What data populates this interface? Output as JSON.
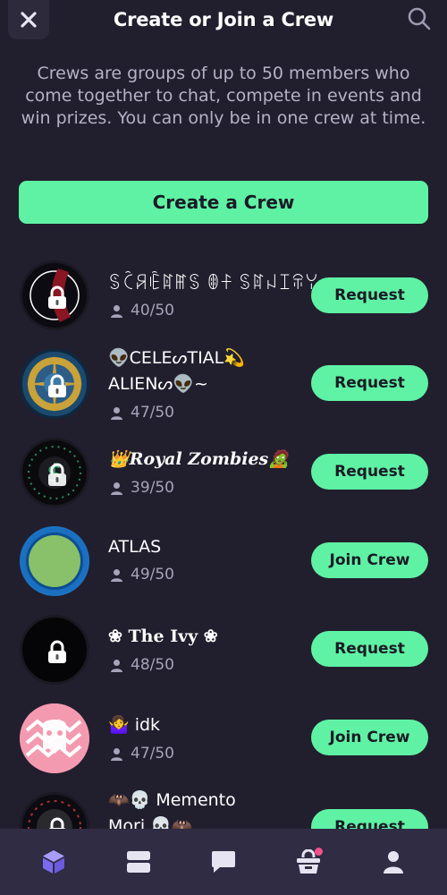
{
  "header": {
    "title": "Create or Join a Crew",
    "close_icon": "close-icon",
    "search_icon": "search-icon"
  },
  "description": "Crews are groups of up to 50 members who come together to chat, compete in events and win prizes. You can only be in one crew at time.",
  "create_button": "Create a Crew",
  "crews": [
    {
      "name_line1": "ꌗꉓꋪꍟꍏꂵꌗ ꂦꊰ ꌗꍏꈤꀤꋖꌩ",
      "name_line2": "",
      "count": "40/50",
      "action": "Request",
      "locked": true
    },
    {
      "name_line1": "👽CELEᔕTIAL💫",
      "name_line2": "ALIENᔕ👽~",
      "count": "47/50",
      "action": "Request",
      "locked": true
    },
    {
      "name_line1": "👑𝑹𝒐𝒚𝒂𝒍 𝒁𝒐𝒎𝒃𝒊𝒆𝒔🧟",
      "name_line2": "",
      "count": "39/50",
      "action": "Request",
      "locked": true
    },
    {
      "name_line1": "ATLAS",
      "name_line2": "",
      "count": "49/50",
      "action": "Join Crew",
      "locked": false
    },
    {
      "name_line1": "❀ 𝐓𝐡𝐞 𝐈𝐯𝐲 ❀",
      "name_line2": "",
      "count": "48/50",
      "action": "Request",
      "locked": true
    },
    {
      "name_line1": "🤷‍♀️ idk",
      "name_line2": "",
      "count": "47/50",
      "action": "Join Crew",
      "locked": false
    },
    {
      "name_line1": "🦇💀 Memento",
      "name_line2": "Mori 💀🦇",
      "count": "",
      "action": "Request",
      "locked": true
    }
  ],
  "bottom_nav": [
    {
      "icon": "crew-cube-icon",
      "active": true
    },
    {
      "icon": "cards-icon",
      "active": false
    },
    {
      "icon": "chat-icon",
      "active": false
    },
    {
      "icon": "shop-icon",
      "active": false,
      "notification": true
    },
    {
      "icon": "profile-icon",
      "active": false
    }
  ],
  "colors": {
    "background": "#211f2e",
    "accent": "#5ff2a4",
    "nav_background": "#2f2c44",
    "active_icon": "#8b7cf6",
    "notification": "#f4508a"
  }
}
